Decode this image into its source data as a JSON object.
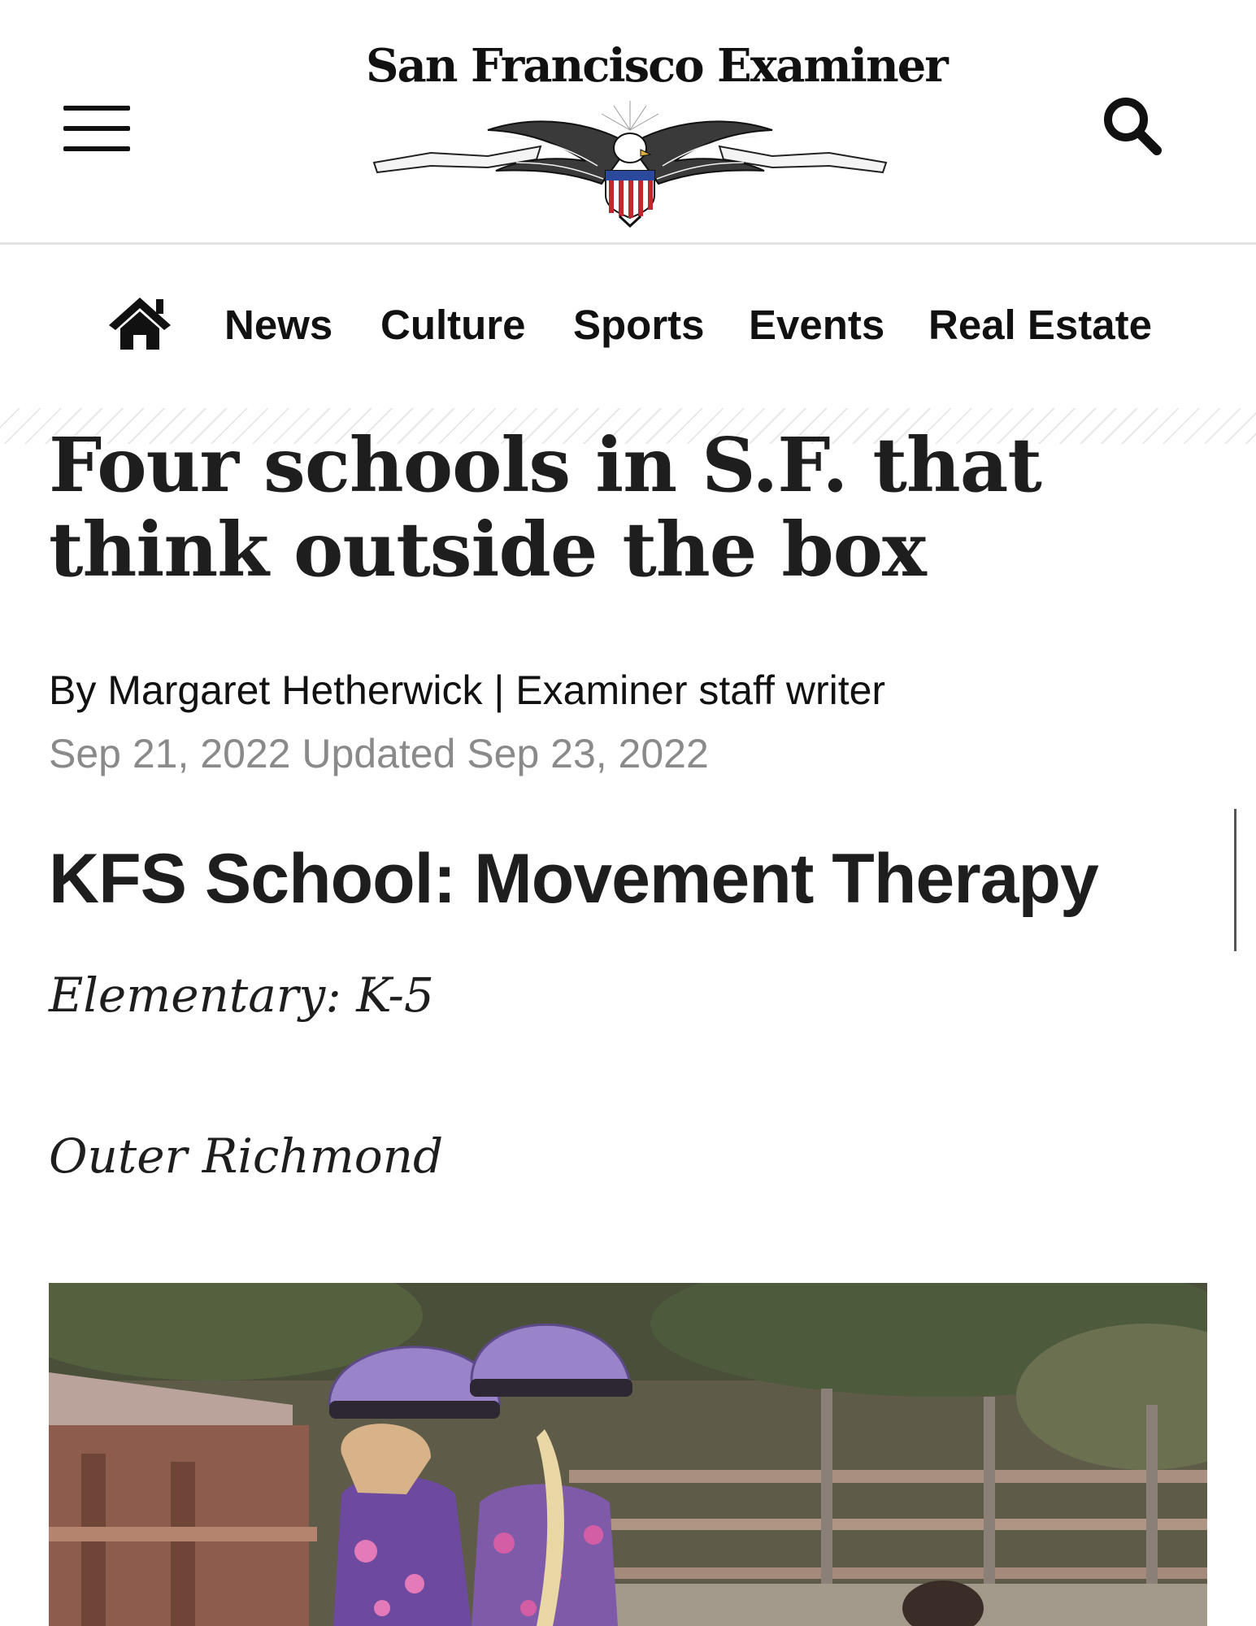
{
  "header": {
    "masthead": "San Francisco Examiner",
    "menu_icon": "hamburger-menu-icon",
    "search_icon": "search-icon"
  },
  "nav": {
    "home_icon": "home-icon",
    "items": [
      {
        "label": "News"
      },
      {
        "label": "Culture"
      },
      {
        "label": "Sports"
      },
      {
        "label": "Events"
      },
      {
        "label": "Real Estate"
      }
    ]
  },
  "article": {
    "headline": "Four schools in S.F. that think outside the box",
    "byline_prefix": "By ",
    "author": "Margaret Hetherwick",
    "author_role": " | Examiner staff writer",
    "dateline": "Sep 21, 2022 Updated Sep 23, 2022",
    "section_heading": "KFS School: Movement Therapy",
    "grade_level": "Elementary: K-5",
    "neighborhood": "Outer Richmond"
  },
  "colors": {
    "text": "#1e1e1e",
    "date_gray": "#8a8a8a",
    "helmet_purple": "#9a84c9"
  }
}
